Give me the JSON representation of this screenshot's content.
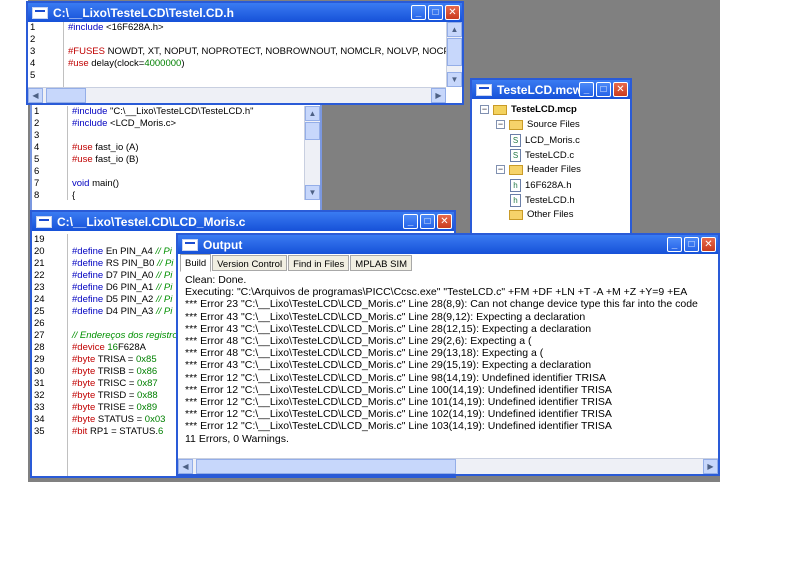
{
  "windows": {
    "header": {
      "title": "C:\\__Lixo\\TesteLCD\\Testel.CD.h",
      "lines": [
        {
          "n": "1",
          "parts": [
            {
              "c": "kw",
              "t": "#include "
            },
            {
              "c": "",
              "t": "<16F628A.h>"
            }
          ]
        },
        {
          "n": "2",
          "parts": [
            {
              "c": "",
              "t": ""
            }
          ]
        },
        {
          "n": "3",
          "parts": [
            {
              "c": "pp",
              "t": "#FUSES "
            },
            {
              "c": "",
              "t": "NOWDT, XT, NOPUT, NOPROTECT, NOBROWNOUT, NOMCLR, NOLVP, NOCPD"
            }
          ]
        },
        {
          "n": "4",
          "parts": [
            {
              "c": "pp",
              "t": "#use "
            },
            {
              "c": "",
              "t": "delay(clock="
            },
            {
              "c": "num",
              "t": "4000000"
            },
            {
              "c": "",
              "t": ")"
            }
          ]
        },
        {
          "n": "5",
          "parts": [
            {
              "c": "",
              "t": ""
            }
          ]
        }
      ]
    },
    "main_c": {
      "lines": [
        {
          "n": "1",
          "parts": [
            {
              "c": "kw",
              "t": "#include "
            },
            {
              "c": "",
              "t": "\"C:\\__Lixo\\TesteLCD\\TesteLCD.h\""
            }
          ]
        },
        {
          "n": "2",
          "parts": [
            {
              "c": "kw",
              "t": "#include "
            },
            {
              "c": "",
              "t": "<LCD_Moris.c>"
            }
          ]
        },
        {
          "n": "3",
          "parts": [
            {
              "c": "",
              "t": ""
            }
          ]
        },
        {
          "n": "4",
          "parts": [
            {
              "c": "pp",
              "t": "#use "
            },
            {
              "c": "",
              "t": "fast_io (A)"
            }
          ]
        },
        {
          "n": "5",
          "parts": [
            {
              "c": "pp",
              "t": "#use "
            },
            {
              "c": "",
              "t": "fast_io (B)"
            }
          ]
        },
        {
          "n": "6",
          "parts": [
            {
              "c": "",
              "t": ""
            }
          ]
        },
        {
          "n": "7",
          "parts": [
            {
              "c": "kw",
              "t": "void "
            },
            {
              "c": "",
              "t": "main()"
            }
          ]
        },
        {
          "n": "8",
          "parts": [
            {
              "c": "",
              "t": "{"
            }
          ]
        }
      ]
    },
    "project": {
      "title": "TesteLCD.mcw",
      "tree": [
        {
          "label": "TesteLCD.mcp",
          "kind": "root",
          "expander": "−"
        },
        {
          "label": "Source Files",
          "kind": "folder",
          "expander": "−"
        },
        {
          "label": "LCD_Moris.c",
          "kind": "file",
          "icon": "S"
        },
        {
          "label": "TesteLCD.c",
          "kind": "file",
          "icon": "S"
        },
        {
          "label": "Header Files",
          "kind": "folder",
          "expander": "−"
        },
        {
          "label": "16F628A.h",
          "kind": "file",
          "icon": "h"
        },
        {
          "label": "TesteLCD.h",
          "kind": "file",
          "icon": "h"
        },
        {
          "label": "Other Files",
          "kind": "folder",
          "expander": ""
        }
      ]
    },
    "lcd": {
      "title": "C:\\__Lixo\\Testel.CD\\LCD_Moris.c",
      "lines": [
        {
          "n": "19",
          "parts": [
            {
              "c": "",
              "t": ""
            }
          ]
        },
        {
          "n": "20",
          "parts": [
            {
              "c": "kw",
              "t": "#define "
            },
            {
              "c": "",
              "t": "En PIN_A4  "
            },
            {
              "c": "cm",
              "t": "// Pi"
            }
          ]
        },
        {
          "n": "21",
          "parts": [
            {
              "c": "kw",
              "t": "#define "
            },
            {
              "c": "",
              "t": "RS PIN_B0  "
            },
            {
              "c": "cm",
              "t": "// Pi"
            }
          ]
        },
        {
          "n": "22",
          "parts": [
            {
              "c": "kw",
              "t": "#define "
            },
            {
              "c": "",
              "t": "D7 PIN_A0  "
            },
            {
              "c": "cm",
              "t": "// Pi"
            }
          ]
        },
        {
          "n": "23",
          "parts": [
            {
              "c": "kw",
              "t": "#define "
            },
            {
              "c": "",
              "t": "D6 PIN_A1  "
            },
            {
              "c": "cm",
              "t": "// Pi"
            }
          ]
        },
        {
          "n": "24",
          "parts": [
            {
              "c": "kw",
              "t": "#define "
            },
            {
              "c": "",
              "t": "D5 PIN_A2  "
            },
            {
              "c": "cm",
              "t": "// Pi"
            }
          ]
        },
        {
          "n": "25",
          "parts": [
            {
              "c": "kw",
              "t": "#define "
            },
            {
              "c": "",
              "t": "D4 PIN_A3  "
            },
            {
              "c": "cm",
              "t": "// Pi"
            }
          ]
        },
        {
          "n": "26",
          "parts": [
            {
              "c": "",
              "t": ""
            }
          ]
        },
        {
          "n": "27",
          "parts": [
            {
              "c": "cm",
              "t": "// Endereços dos registro"
            }
          ]
        },
        {
          "n": "28",
          "parts": [
            {
              "c": "pp",
              "t": "#device "
            },
            {
              "c": "num",
              "t": "16"
            },
            {
              "c": "",
              "t": "F628A"
            }
          ]
        },
        {
          "n": "29",
          "parts": [
            {
              "c": "pp",
              "t": "#byte "
            },
            {
              "c": "",
              "t": "TRISA = "
            },
            {
              "c": "num",
              "t": "0x85"
            }
          ]
        },
        {
          "n": "30",
          "parts": [
            {
              "c": "pp",
              "t": "#byte "
            },
            {
              "c": "",
              "t": "TRISB = "
            },
            {
              "c": "num",
              "t": "0x86"
            }
          ]
        },
        {
          "n": "31",
          "parts": [
            {
              "c": "pp",
              "t": "#byte "
            },
            {
              "c": "",
              "t": "TRISC = "
            },
            {
              "c": "num",
              "t": "0x87"
            }
          ]
        },
        {
          "n": "32",
          "parts": [
            {
              "c": "pp",
              "t": "#byte "
            },
            {
              "c": "",
              "t": "TRISD = "
            },
            {
              "c": "num",
              "t": "0x88"
            }
          ]
        },
        {
          "n": "33",
          "parts": [
            {
              "c": "pp",
              "t": "#byte "
            },
            {
              "c": "",
              "t": "TRISE = "
            },
            {
              "c": "num",
              "t": "0x89"
            }
          ]
        },
        {
          "n": "34",
          "parts": [
            {
              "c": "pp",
              "t": "#byte "
            },
            {
              "c": "",
              "t": "STATUS = "
            },
            {
              "c": "num",
              "t": "0x03"
            }
          ]
        },
        {
          "n": "35",
          "parts": [
            {
              "c": "pp",
              "t": "#bit "
            },
            {
              "c": "",
              "t": "RP1 = STATUS."
            },
            {
              "c": "num",
              "t": "6"
            }
          ]
        }
      ]
    },
    "output": {
      "title": "Output",
      "tabs": [
        "Build",
        "Version Control",
        "Find in Files",
        "MPLAB SIM"
      ],
      "lines": [
        "Clean: Done.",
        "Executing: \"C:\\Arquivos de programas\\PICC\\Ccsc.exe\" \"TesteLCD.c\" +FM +DF +LN +T -A +M +Z +Y=9 +EA",
        "*** Error 23 \"C:\\__Lixo\\TesteLCD\\LCD_Moris.c\" Line 28(8,9): Can not change device type this far into the code",
        "*** Error 43 \"C:\\__Lixo\\TesteLCD\\LCD_Moris.c\" Line 28(9,12): Expecting a declaration",
        "*** Error 43 \"C:\\__Lixo\\TesteLCD\\LCD_Moris.c\" Line 28(12,15): Expecting a declaration",
        "*** Error 48 \"C:\\__Lixo\\TesteLCD\\LCD_Moris.c\" Line 29(2,6): Expecting a (",
        "*** Error 48 \"C:\\__Lixo\\TesteLCD\\LCD_Moris.c\" Line 29(13,18): Expecting a (",
        "*** Error 43 \"C:\\__Lixo\\TesteLCD\\LCD_Moris.c\" Line 29(15,19): Expecting a declaration",
        "*** Error 12 \"C:\\__Lixo\\TesteLCD\\LCD_Moris.c\" Line 98(14,19): Undefined identifier   TRISA",
        "*** Error 12 \"C:\\__Lixo\\TesteLCD\\LCD_Moris.c\" Line 100(14,19): Undefined identifier   TRISA",
        "*** Error 12 \"C:\\__Lixo\\TesteLCD\\LCD_Moris.c\" Line 101(14,19): Undefined identifier   TRISA",
        "*** Error 12 \"C:\\__Lixo\\TesteLCD\\LCD_Moris.c\" Line 102(14,19): Undefined identifier   TRISA",
        "*** Error 12 \"C:\\__Lixo\\TesteLCD\\LCD_Moris.c\" Line 103(14,19): Undefined identifier   TRISA",
        "      11 Errors,  0 Warnings."
      ]
    }
  },
  "titlebar_buttons": {
    "minimize": "_",
    "maximize": "□",
    "close": "✕"
  },
  "colors": {
    "title_active": "#1651d8",
    "title_inactive": "#7592d8",
    "mdi_background": "#808080"
  }
}
